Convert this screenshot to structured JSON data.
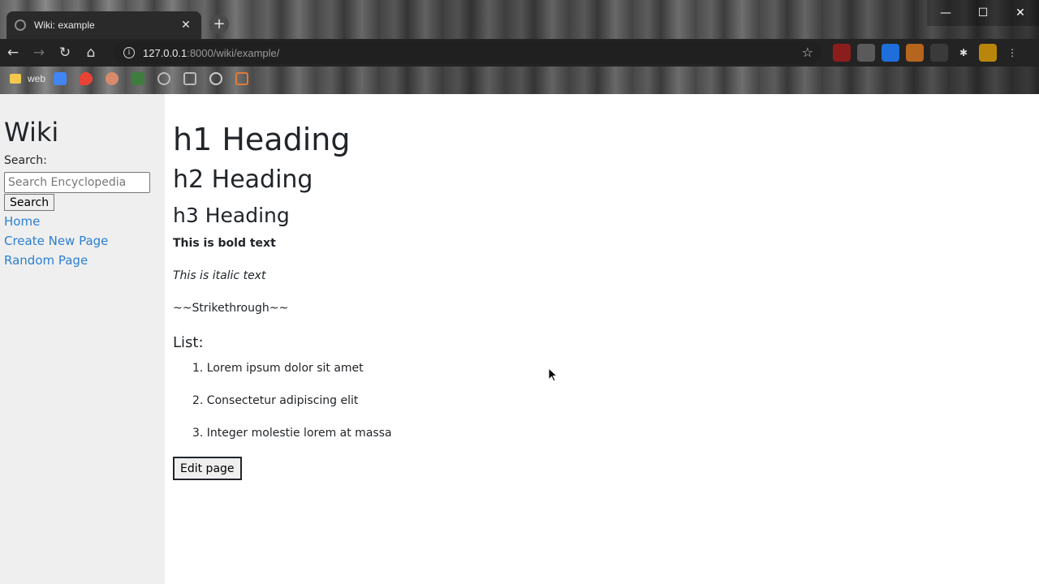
{
  "browser": {
    "tab_title": "Wiki: example",
    "tab_close": "✕",
    "new_tab": "+",
    "url_host": "127.0.0.1",
    "url_path": ":8000/wiki/example/",
    "window_controls": {
      "minimize": "—",
      "maximize": "☐",
      "close": "✕"
    },
    "bookmarks": [
      {
        "label": "web"
      }
    ]
  },
  "sidebar": {
    "title": "Wiki",
    "search_label": "Search:",
    "search_placeholder": "Search Encyclopedia",
    "search_button": "Search",
    "links": [
      "Home",
      "Create New Page",
      "Random Page"
    ]
  },
  "content": {
    "h1": "h1 Heading",
    "h2": "h2 Heading",
    "h3": "h3 Heading",
    "bold": "This is bold text",
    "italic": "This is italic text",
    "strikethrough": "~~Strikethrough~~",
    "list_heading": "List:",
    "list_items": [
      "1. Lorem ipsum dolor sit amet",
      "2. Consectetur adipiscing elit",
      "3. Integer molestie lorem at massa"
    ],
    "edit_button": "Edit page"
  },
  "colors": {
    "link": "#2c7fd1",
    "sidebar_bg": "#efefef",
    "text": "#212529"
  }
}
